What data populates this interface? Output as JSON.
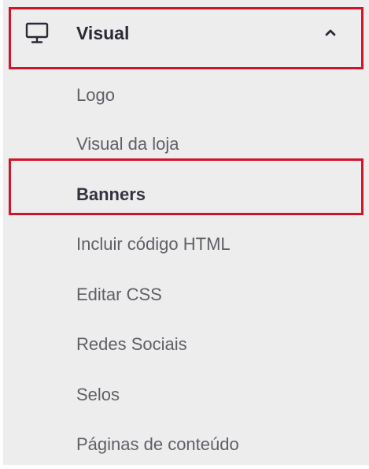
{
  "menu": {
    "section": {
      "title": "Visual",
      "icon": "monitor-icon",
      "expand_icon": "chevron-up-icon"
    },
    "items": [
      {
        "label": "Logo",
        "active": false
      },
      {
        "label": "Visual da loja",
        "active": false
      },
      {
        "label": "Banners",
        "active": true
      },
      {
        "label": "Incluir código HTML",
        "active": false
      },
      {
        "label": "Editar CSS",
        "active": false
      },
      {
        "label": "Redes Sociais",
        "active": false
      },
      {
        "label": "Selos",
        "active": false
      },
      {
        "label": "Páginas de conteúdo",
        "active": false
      }
    ]
  },
  "colors": {
    "panel_background": "#ededee",
    "highlight_border": "#d0142a",
    "title_text": "#2b2a35",
    "item_text": "#5f5f66",
    "active_item_text": "#34323f"
  }
}
